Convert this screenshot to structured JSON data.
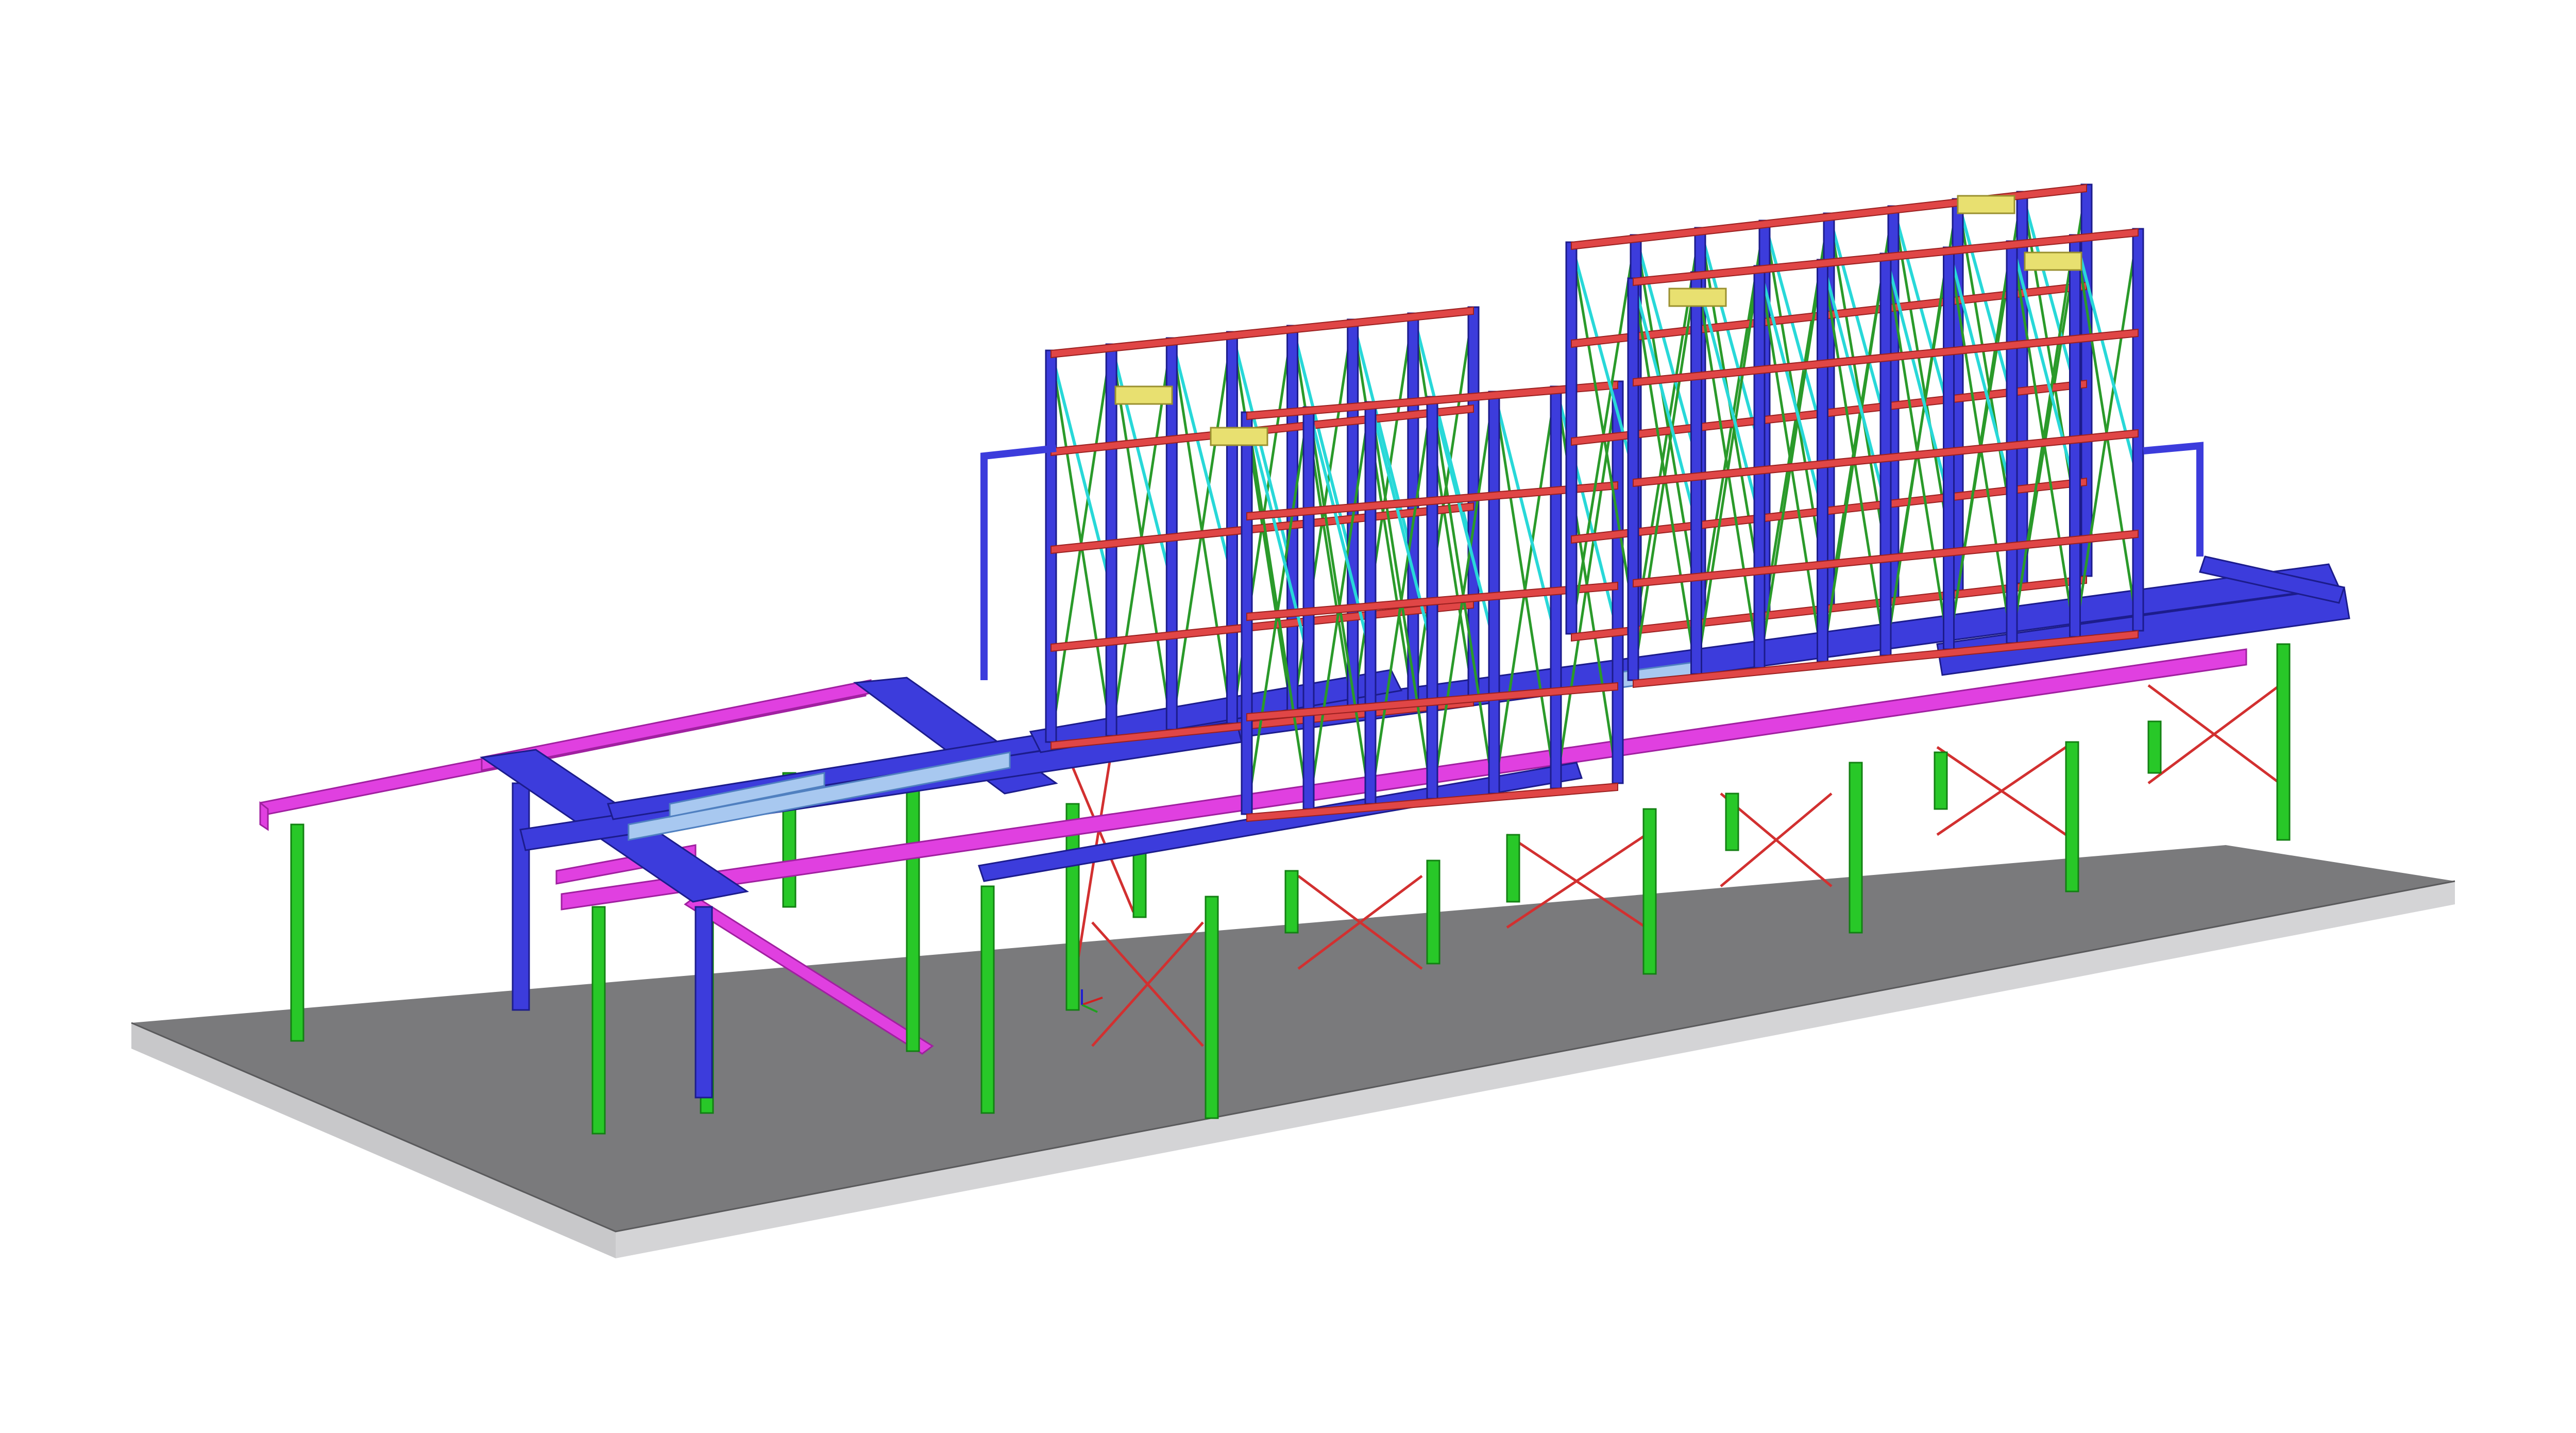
{
  "view": {
    "background": "#ffffff",
    "description_color_legend": {
      "columns": "#28c828",
      "main_beams": "#3c3cdc",
      "secondary_beams": "#e04646",
      "bracing_tower": "#28d8d8",
      "bracing_diagonal": "#2a9a2a",
      "perimeter_beams": "#e040e0",
      "ground_bracing": "#d23030",
      "light_beams": "#a8c8f0",
      "equipment": "#e8e070",
      "slab_top": "#7a7a7c",
      "slab_side": "#c8c8ca"
    }
  },
  "axis_triad": {
    "icon": "coordinate-axes-icon",
    "colors": {
      "x": "#d02020",
      "y": "#20a020",
      "z": "#2020d0"
    }
  }
}
